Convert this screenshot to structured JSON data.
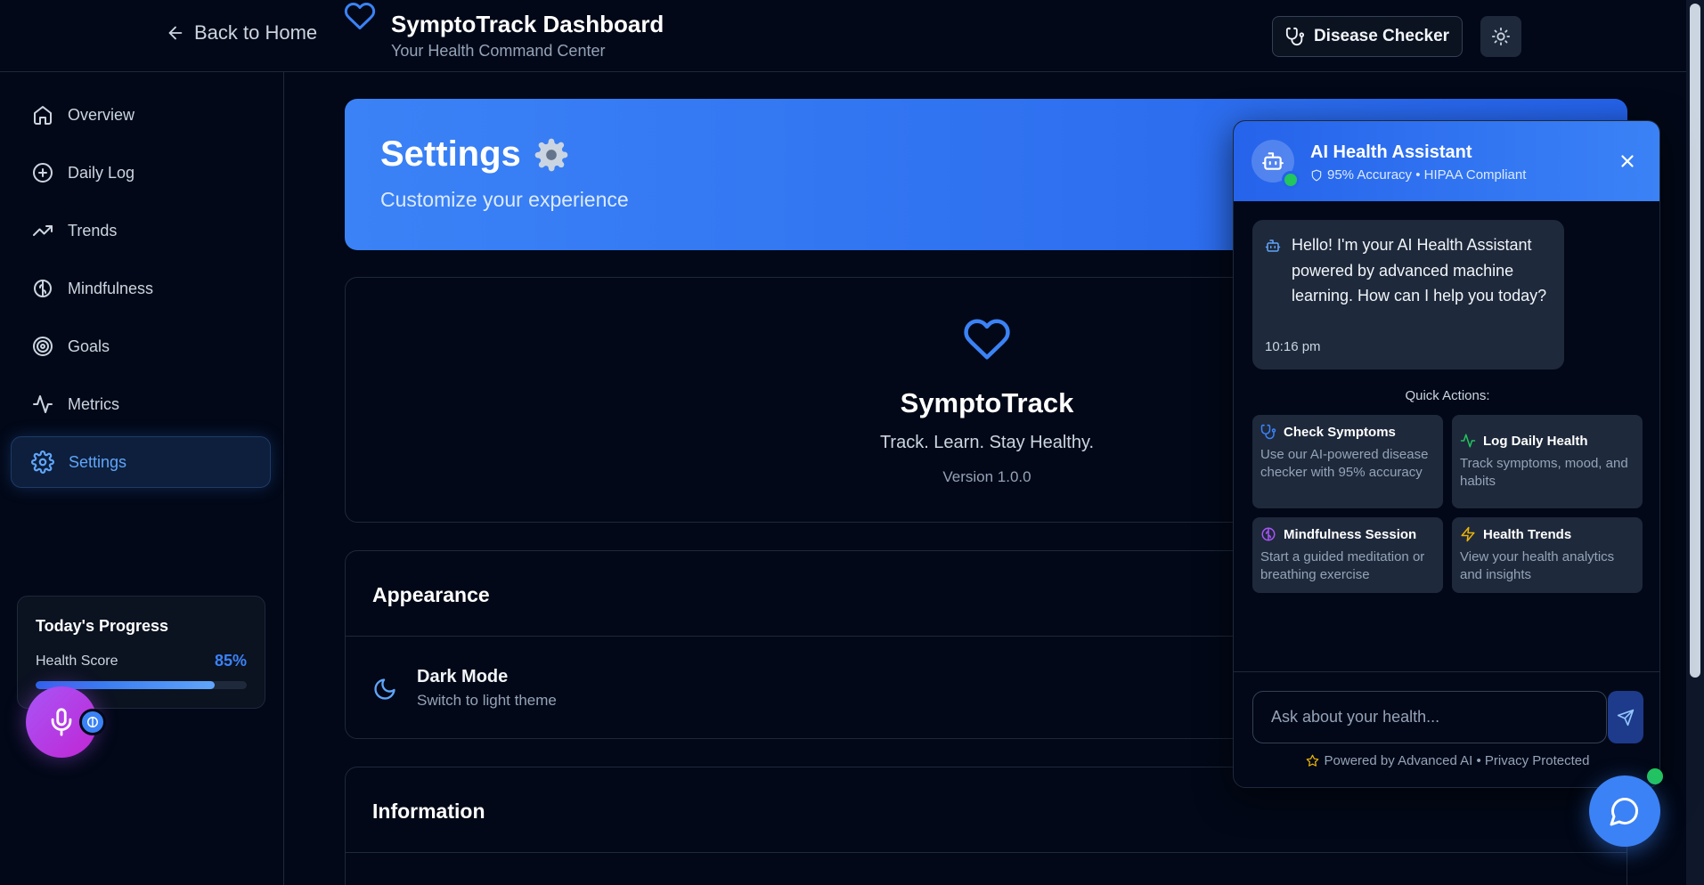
{
  "header": {
    "back_label": "Back to Home",
    "title": "SymptoTrack Dashboard",
    "subtitle": "Your Health Command Center",
    "disease_checker_label": "Disease Checker"
  },
  "sidebar": {
    "items": [
      {
        "label": "Overview",
        "icon": "home-icon"
      },
      {
        "label": "Daily Log",
        "icon": "plus-circle-icon"
      },
      {
        "label": "Trends",
        "icon": "trending-up-icon"
      },
      {
        "label": "Mindfulness",
        "icon": "brain-icon"
      },
      {
        "label": "Goals",
        "icon": "target-icon"
      },
      {
        "label": "Metrics",
        "icon": "activity-icon"
      },
      {
        "label": "Settings",
        "icon": "settings-icon",
        "active": true
      }
    ],
    "progress": {
      "title": "Today's Progress",
      "label": "Health Score",
      "value_text": "85%",
      "value": 0.85
    }
  },
  "banner": {
    "title": "Settings",
    "emoji": "⚙️",
    "subtitle": "Customize your experience"
  },
  "about": {
    "app_name": "SymptoTrack",
    "tagline": "Track. Learn. Stay Healthy.",
    "version": "Version 1.0.0"
  },
  "appearance": {
    "title": "Appearance",
    "dark_mode_title": "Dark Mode",
    "dark_mode_sub": "Switch to light theme"
  },
  "information": {
    "title": "Information"
  },
  "chat": {
    "title": "AI Health Assistant",
    "subtitle": "95% Accuracy • HIPAA Compliant",
    "message": "Hello! I'm your AI Health Assistant powered by advanced machine learning. How can I help you today?",
    "time": "10:16 pm",
    "quick_actions_label": "Quick Actions:",
    "quick_actions": [
      {
        "title": "Check Symptoms",
        "desc": "Use our AI-powered disease checker with 95% accuracy",
        "icon": "stethoscope-icon",
        "color": "#3b82f6"
      },
      {
        "title": "Log Daily Health",
        "desc": "Track symptoms, mood, and habits",
        "icon": "activity-icon",
        "color": "#22c55e"
      },
      {
        "title": "Mindfulness Session",
        "desc": "Start a guided meditation or breathing exercise",
        "icon": "brain-icon",
        "color": "#a855f7"
      },
      {
        "title": "Health Trends",
        "desc": "View your health analytics and insights",
        "icon": "zap-icon",
        "color": "#eab308"
      }
    ],
    "input_placeholder": "Ask about your health...",
    "powered_by": "Powered by Advanced AI • Privacy Protected"
  }
}
